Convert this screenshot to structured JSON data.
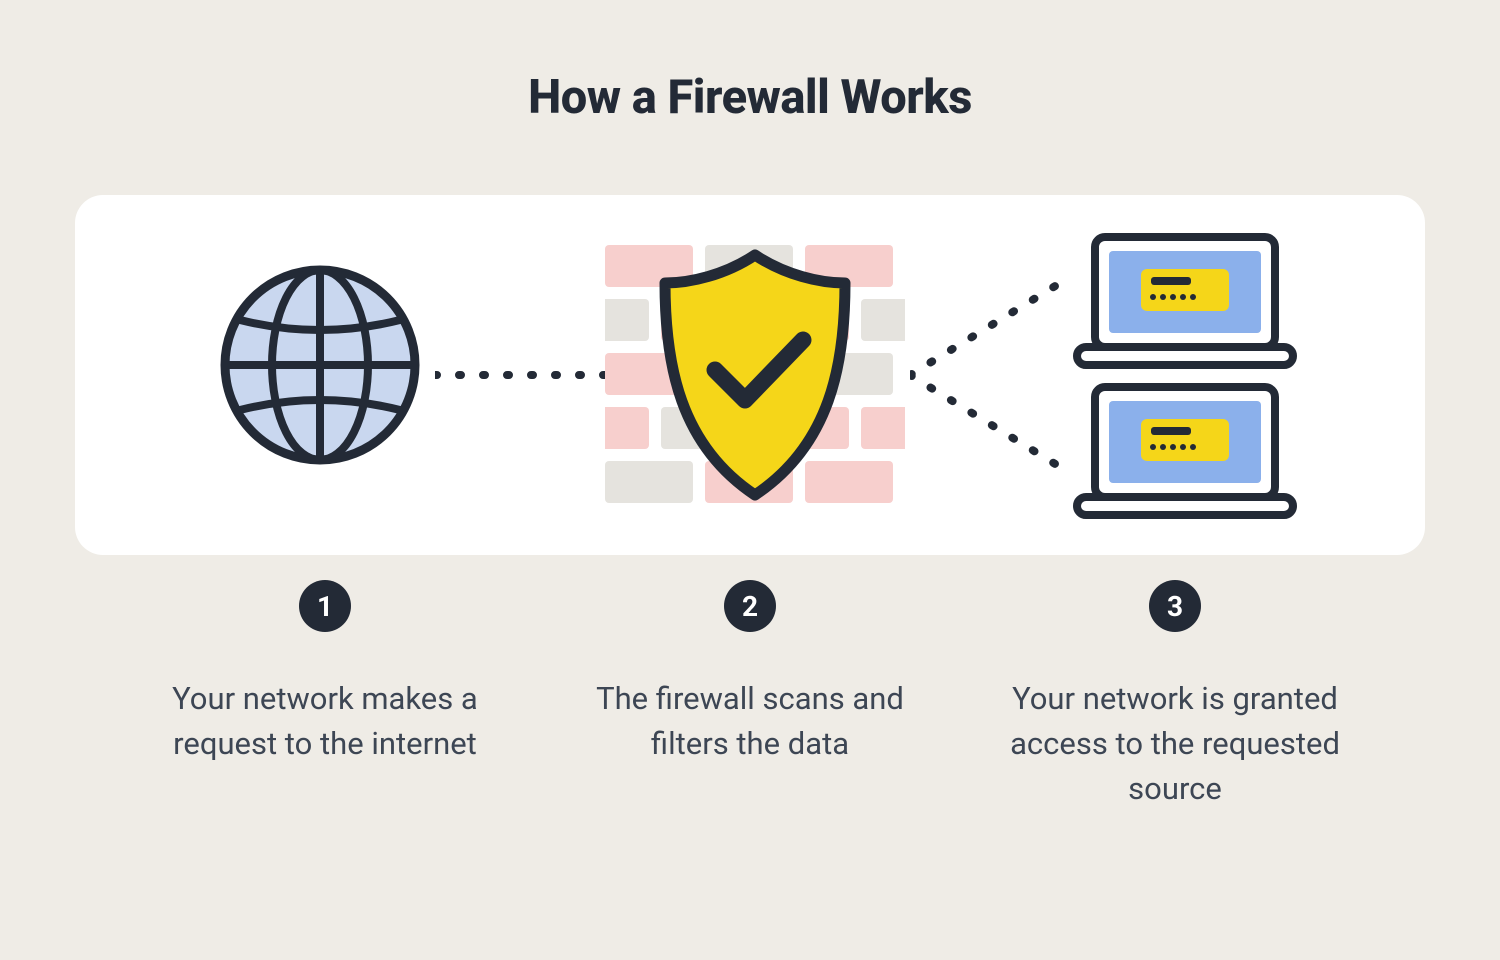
{
  "title": "How a Firewall Works",
  "steps": [
    {
      "num": "1",
      "text": "Your network makes a request to the internet"
    },
    {
      "num": "2",
      "text": "The firewall scans and filters the data"
    },
    {
      "num": "3",
      "text": "Your network is granted access to the requested source"
    }
  ],
  "colors": {
    "bg": "#efece6",
    "panel": "#ffffff",
    "stroke": "#232a36",
    "globe_fill": "#c9d7ef",
    "shield_fill": "#f5d619",
    "brick_pink": "#f7cfcd",
    "brick_gray": "#e5e3de",
    "laptop_screen": "#8bb0eb",
    "laptop_body": "#ffffff",
    "laptop_card": "#f5d619"
  }
}
